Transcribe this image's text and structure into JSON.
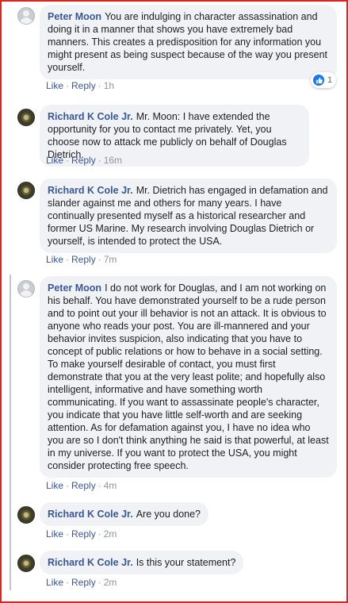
{
  "actions": {
    "like_label": "Like",
    "reply_label": "Reply",
    "separator": "·"
  },
  "comments": [
    {
      "author": "Peter Moon",
      "avatar": "default-user-icon",
      "text": "You are indulging in character assassination and doing it in a manner that shows you have extremely bad manners. This creates a predisposition for any information you might present as being suspect because of the way you present yourself.",
      "time": "1h",
      "reactions": {
        "icon": "like-reaction-icon",
        "count": "1"
      }
    },
    {
      "author": "Richard K Cole Jr.",
      "avatar": "profile-photo-emblem",
      "text": "Mr. Moon: I have extended the opportunity for you to contact me privately. Yet, you choose now to attack me publicly on behalf of Douglas Dietrich.",
      "time": "16m"
    },
    {
      "author": "Richard K Cole Jr.",
      "avatar": "profile-photo-emblem",
      "text": "Mr. Dietrich has engaged in defamation and slander against me and others for many years. I have continually presented myself as a historical researcher and former US Marine. My research involving Douglas Dietrich or yourself, is intended to protect the USA.",
      "time": "7m"
    },
    {
      "author": "Peter Moon",
      "avatar": "default-user-icon",
      "text": "I do not work for Douglas, and I am not working on his behalf. You have demonstrated yourself to be a rude person and to point out your ill behavior is not an attack. It is obvious to anyone who reads your post. You are ill-mannered and your behavior invites suspicion, also indicating that you have to concept of public relations or how to behave in a social setting. To make yourself desirable of contact, you must first demonstrate that you at the very least polite; and hopefully also intelligent, informative and have something worth communicating. If you want to assassinate people's character, you indicate that you have little self-worth and are seeking attention. As for defamation against you, I have no idea who you are so I don't think anything he said is that powerful, at least in my universe. If you want to protect the USA, you might consider protecting free speech.",
      "time": "4m"
    },
    {
      "author": "Richard K Cole Jr.",
      "avatar": "profile-photo-emblem",
      "text": "Are you done?",
      "time": "2m"
    },
    {
      "author": "Richard K Cole Jr.",
      "avatar": "profile-photo-emblem",
      "text": "Is this your statement?",
      "time": "2m"
    }
  ]
}
